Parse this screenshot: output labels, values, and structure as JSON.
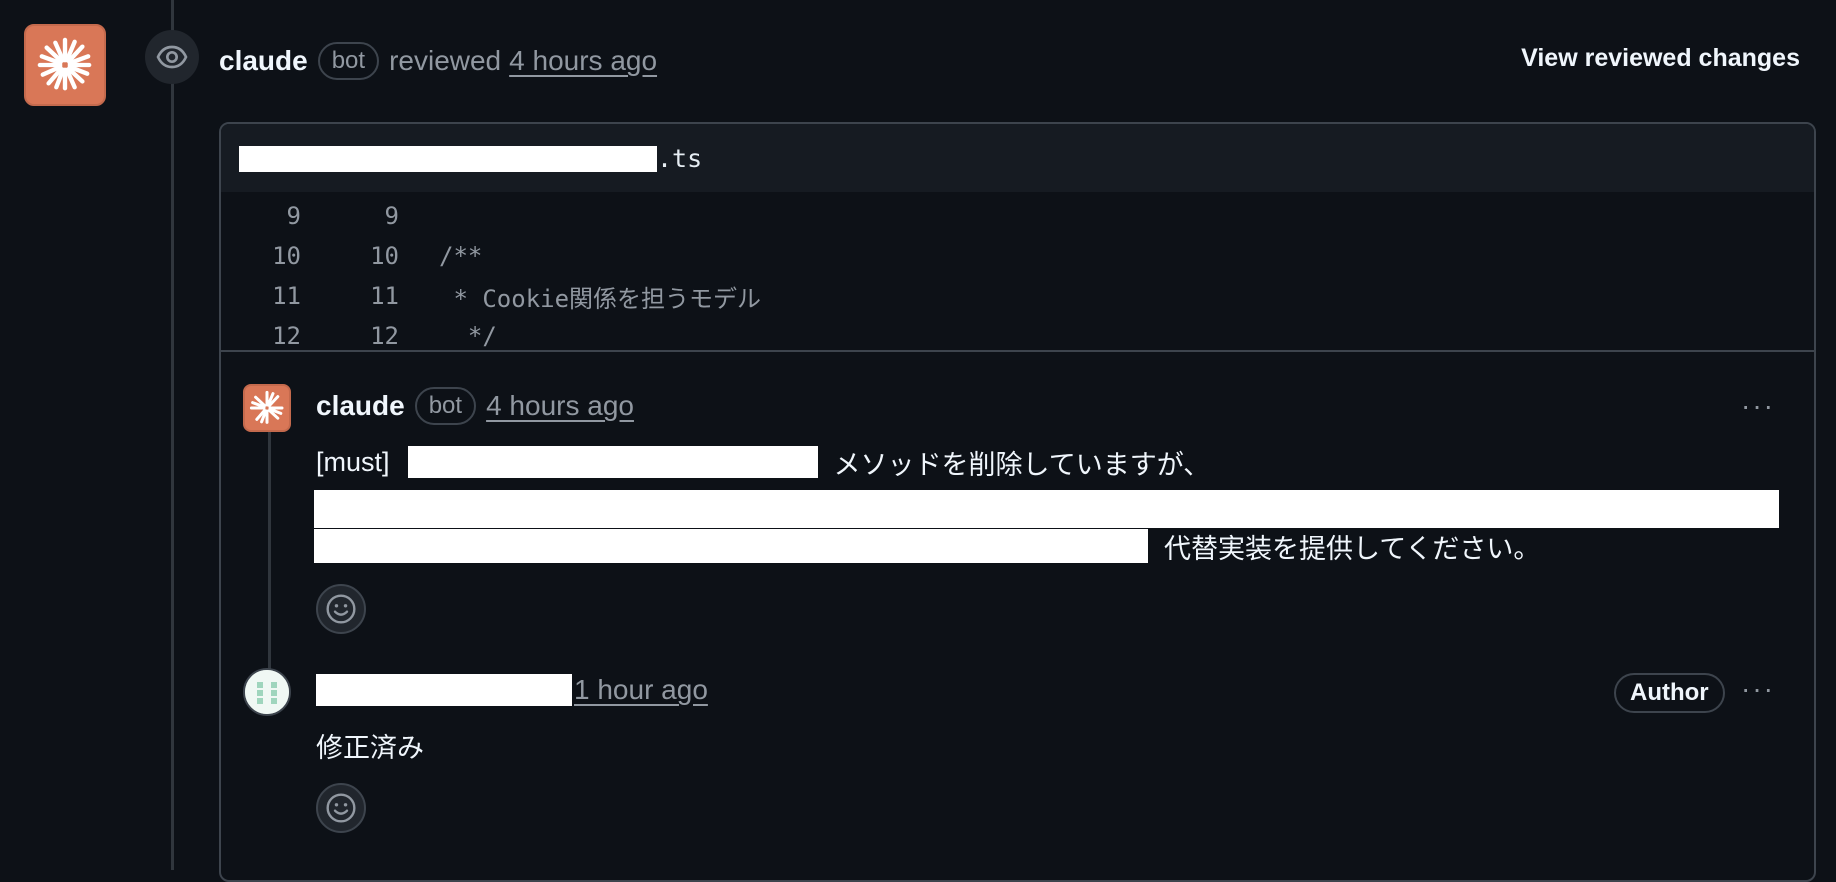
{
  "review": {
    "author": "claude",
    "bot_label": "bot",
    "action": "reviewed",
    "time": "4 hours ago",
    "view_changes_label": "View reviewed changes"
  },
  "file": {
    "extension": ".ts",
    "lines": [
      {
        "old": "9",
        "new": "9",
        "code": ""
      },
      {
        "old": "10",
        "new": "10",
        "code": "/**"
      },
      {
        "old": "11",
        "new": "11",
        "code": " * Cookie関係を担うモデル"
      },
      {
        "old": "12",
        "new": "12",
        "code": "  */"
      }
    ]
  },
  "comments": [
    {
      "author": "claude",
      "bot_label": "bot",
      "time": "4 hours ago",
      "tag": "[must]",
      "text_part1": "メソッドを削除していますが、",
      "text_part2": "代替実装を提供してください。",
      "more": "···"
    },
    {
      "time": "1 hour ago",
      "author_badge": "Author",
      "text": "修正済み",
      "more": "···"
    }
  ],
  "icons": {
    "avatar": "claude-logo-icon",
    "timeline": "eye-icon",
    "reaction": "smiley-icon"
  },
  "colors": {
    "background": "#0d1117",
    "claude_accent": "#d97757",
    "border": "#3d444d",
    "muted": "#9198a1"
  }
}
